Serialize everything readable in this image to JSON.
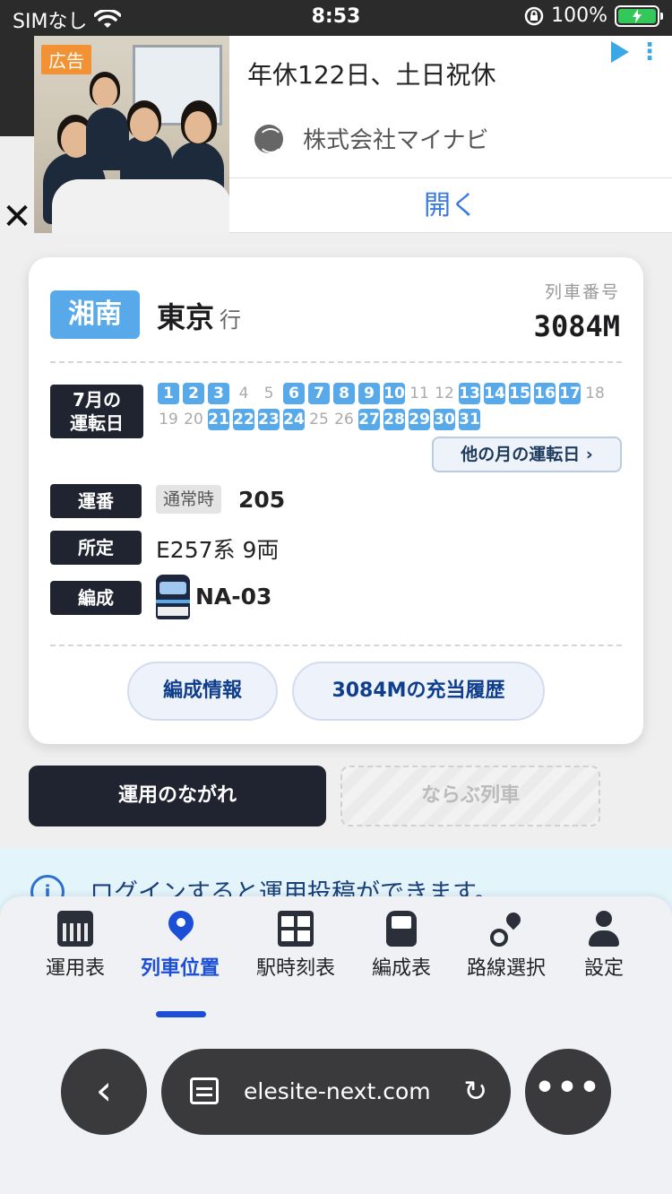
{
  "status_bar": {
    "carrier": "SIMなし",
    "time": "8:53",
    "battery": "100%",
    "icons": [
      "wifi-icon",
      "orientation-lock-icon",
      "battery-charging-icon"
    ]
  },
  "ad": {
    "badge": "広告",
    "title": "年休122日、土日祝休",
    "company": "株式会社マイナビ",
    "open_label": "開く",
    "close_label": "✕"
  },
  "train": {
    "line": "湘南",
    "destination": "東京",
    "destination_suffix": "行",
    "number_label": "列車番号",
    "number": "3084M",
    "line_color": "#58a9ea",
    "calendar": {
      "label_line1": "7月の",
      "label_line2": "運転日",
      "rows": [
        [
          {
            "d": "1",
            "on": true
          },
          {
            "d": "2",
            "on": true
          },
          {
            "d": "3",
            "on": true
          },
          {
            "d": "4",
            "on": false
          },
          {
            "d": "5",
            "on": false
          },
          {
            "d": "6",
            "on": true
          },
          {
            "d": "7",
            "on": true
          },
          {
            "d": "8",
            "on": true
          },
          {
            "d": "9",
            "on": true
          },
          {
            "d": "10",
            "on": true
          },
          {
            "d": "11",
            "on": false
          },
          {
            "d": "12",
            "on": false
          },
          {
            "d": "13",
            "on": true
          },
          {
            "d": "14",
            "on": true
          },
          {
            "d": "15",
            "on": true
          },
          {
            "d": "16",
            "on": true
          },
          {
            "d": "17",
            "on": true
          },
          {
            "d": "18",
            "on": false
          }
        ],
        [
          {
            "d": "19",
            "on": false
          },
          {
            "d": "20",
            "on": false
          },
          {
            "d": "21",
            "on": true
          },
          {
            "d": "22",
            "on": true
          },
          {
            "d": "23",
            "on": true
          },
          {
            "d": "24",
            "on": true
          },
          {
            "d": "25",
            "on": false
          },
          {
            "d": "26",
            "on": false
          },
          {
            "d": "27",
            "on": true
          },
          {
            "d": "28",
            "on": true
          },
          {
            "d": "29",
            "on": true
          },
          {
            "d": "30",
            "on": true
          },
          {
            "d": "31",
            "on": true
          }
        ]
      ],
      "other_month_label": "他の月の運転日 ›"
    },
    "operation": {
      "label": "運番",
      "chip": "通常時",
      "value": "205"
    },
    "assigned": {
      "label": "所定",
      "value": "E257系 9両"
    },
    "formation": {
      "label": "編成",
      "value": "NA-03"
    },
    "buttons": {
      "formation_info": "編成情報",
      "history": "3084Mの充当履歴"
    }
  },
  "mode_tabs": {
    "active": "運用のながれ",
    "inactive": "ならぶ列車"
  },
  "notice": {
    "icon": "i",
    "text": "ログインすると運用投稿ができます。"
  },
  "nav": [
    {
      "label": "運用表",
      "icon": "calendar-icon"
    },
    {
      "label": "列車位置",
      "icon": "map-pin-icon",
      "active": true
    },
    {
      "label": "駅時刻表",
      "icon": "grid-icon"
    },
    {
      "label": "編成表",
      "icon": "train-icon"
    },
    {
      "label": "路線選択",
      "icon": "route-icon"
    },
    {
      "label": "設定",
      "icon": "user-icon"
    }
  ],
  "browser": {
    "url": "elesite-next.com",
    "back_label": "‹",
    "more_label": "•••",
    "reload_label": "↻"
  }
}
